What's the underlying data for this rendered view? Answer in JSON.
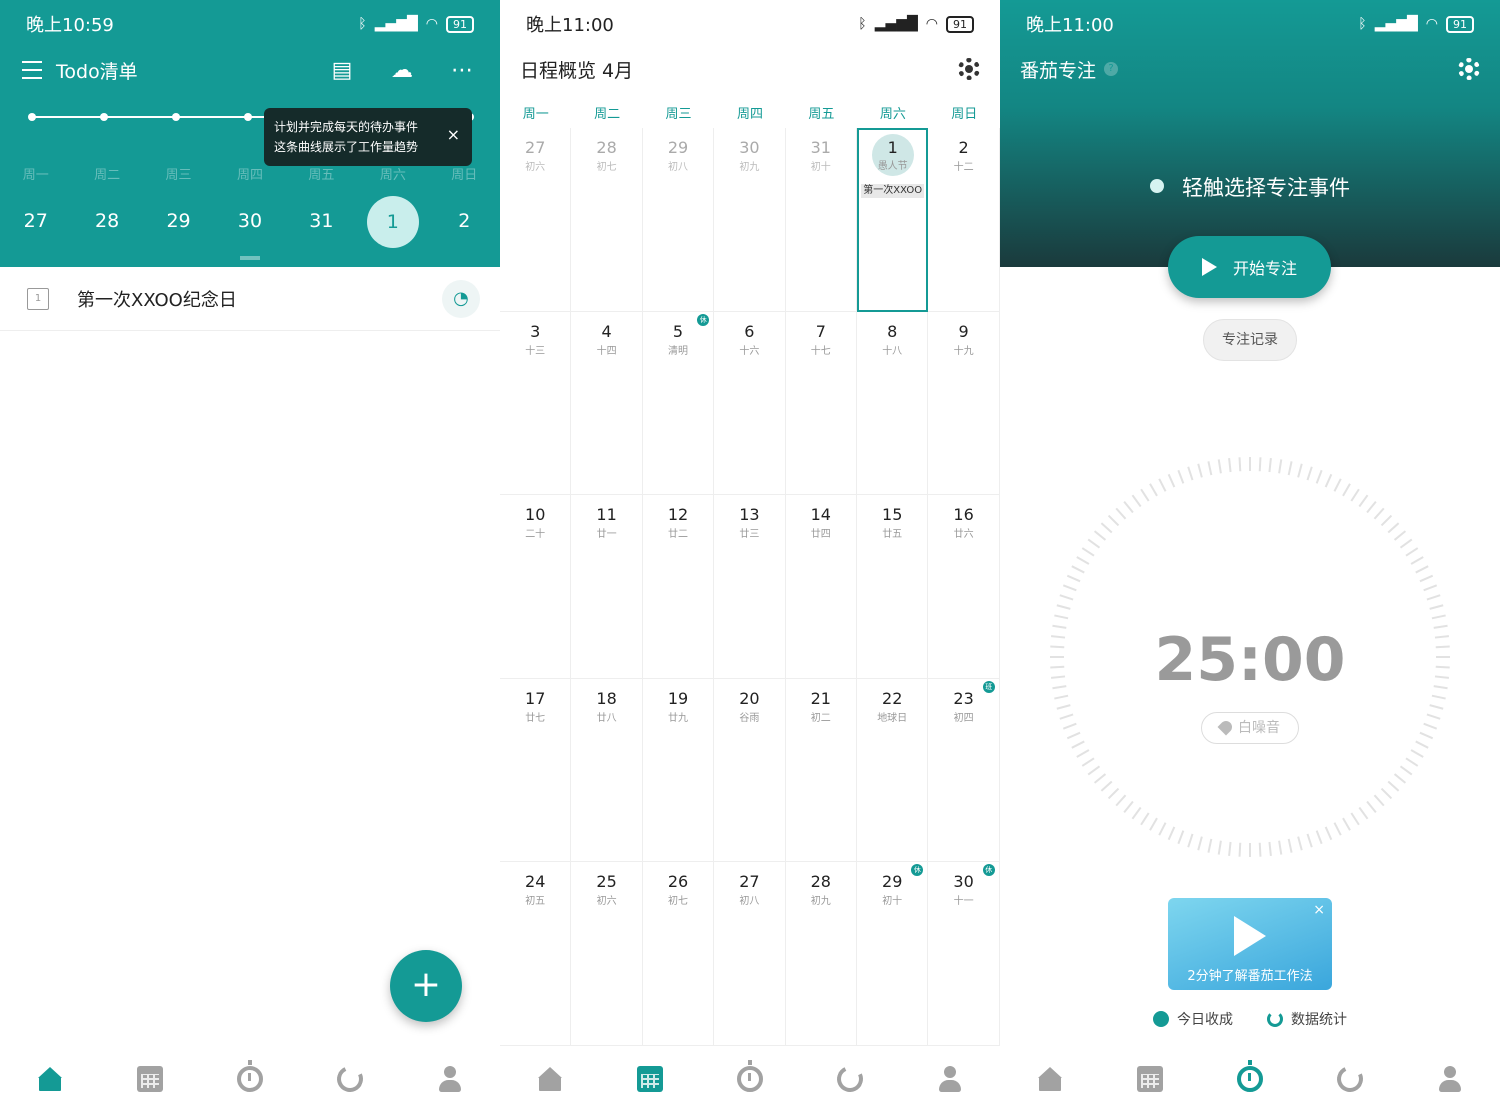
{
  "colors": {
    "accent": "#149a95",
    "accent_light": "#c9eeec",
    "icon_inactive": "#a2a2a2"
  },
  "panel1": {
    "status": {
      "time": "晚上10:59",
      "battery": "91"
    },
    "title": "Todo清单",
    "icons": [
      "menu-icon",
      "inbox-icon",
      "cloud-off-icon",
      "more-icon"
    ],
    "tooltip": {
      "line1": "计划并完成每天的待办事件",
      "line2": "这条曲线展示了工作量趋势",
      "close": "×"
    },
    "week_headers": [
      "周一",
      "周二",
      "周三",
      "周四",
      "周五",
      "周六",
      "周日"
    ],
    "week_days": [
      "27",
      "28",
      "29",
      "30",
      "31",
      "1",
      "2"
    ],
    "selected_index": 5,
    "todo": {
      "box_label": "1",
      "text": "第一次XXOO纪念日"
    },
    "fab": "+"
  },
  "panel2": {
    "status": {
      "time": "晚上11:00",
      "battery": "91"
    },
    "title": "日程概览  4月",
    "dow": [
      "周一",
      "周二",
      "周三",
      "周四",
      "周五",
      "周六",
      "周日"
    ],
    "cells": [
      {
        "d": "27",
        "l": "初六",
        "dim": true
      },
      {
        "d": "28",
        "l": "初七",
        "dim": true
      },
      {
        "d": "29",
        "l": "初八",
        "dim": true
      },
      {
        "d": "30",
        "l": "初九",
        "dim": true
      },
      {
        "d": "31",
        "l": "初十",
        "dim": true
      },
      {
        "d": "1",
        "l": "愚人节",
        "today": true,
        "event": "第一次XXOO"
      },
      {
        "d": "2",
        "l": "十二"
      },
      {
        "d": "3",
        "l": "十三"
      },
      {
        "d": "4",
        "l": "十四"
      },
      {
        "d": "5",
        "l": "清明",
        "badge": "休"
      },
      {
        "d": "6",
        "l": "十六"
      },
      {
        "d": "7",
        "l": "十七"
      },
      {
        "d": "8",
        "l": "十八"
      },
      {
        "d": "9",
        "l": "十九"
      },
      {
        "d": "10",
        "l": "二十"
      },
      {
        "d": "11",
        "l": "廿一"
      },
      {
        "d": "12",
        "l": "廿二"
      },
      {
        "d": "13",
        "l": "廿三"
      },
      {
        "d": "14",
        "l": "廿四"
      },
      {
        "d": "15",
        "l": "廿五"
      },
      {
        "d": "16",
        "l": "廿六"
      },
      {
        "d": "17",
        "l": "廿七"
      },
      {
        "d": "18",
        "l": "廿八"
      },
      {
        "d": "19",
        "l": "廿九"
      },
      {
        "d": "20",
        "l": "谷雨"
      },
      {
        "d": "21",
        "l": "初二"
      },
      {
        "d": "22",
        "l": "地球日"
      },
      {
        "d": "23",
        "l": "初四",
        "badge": "班"
      },
      {
        "d": "24",
        "l": "初五"
      },
      {
        "d": "25",
        "l": "初六"
      },
      {
        "d": "26",
        "l": "初七"
      },
      {
        "d": "27",
        "l": "初八"
      },
      {
        "d": "28",
        "l": "初九"
      },
      {
        "d": "29",
        "l": "初十",
        "badge": "休"
      },
      {
        "d": "30",
        "l": "十一",
        "badge": "休"
      }
    ]
  },
  "panel3": {
    "status": {
      "time": "晚上11:00",
      "battery": "91"
    },
    "title": "番茄专注",
    "help": "?",
    "choose": "轻触选择专注事件",
    "start": "开始专注",
    "records": "专注记录",
    "timer": "25:00",
    "white_noise": "白噪音",
    "video_caption": "2分钟了解番茄工作法",
    "video_close": "×",
    "today_harvest": "今日收成",
    "data_stats": "数据统计"
  },
  "nav_items": [
    {
      "name": "nav-home",
      "icon": "home"
    },
    {
      "name": "nav-calendar",
      "icon": "cal"
    },
    {
      "name": "nav-timer",
      "icon": "timer"
    },
    {
      "name": "nav-stats",
      "icon": "ring"
    },
    {
      "name": "nav-profile",
      "icon": "user"
    }
  ]
}
